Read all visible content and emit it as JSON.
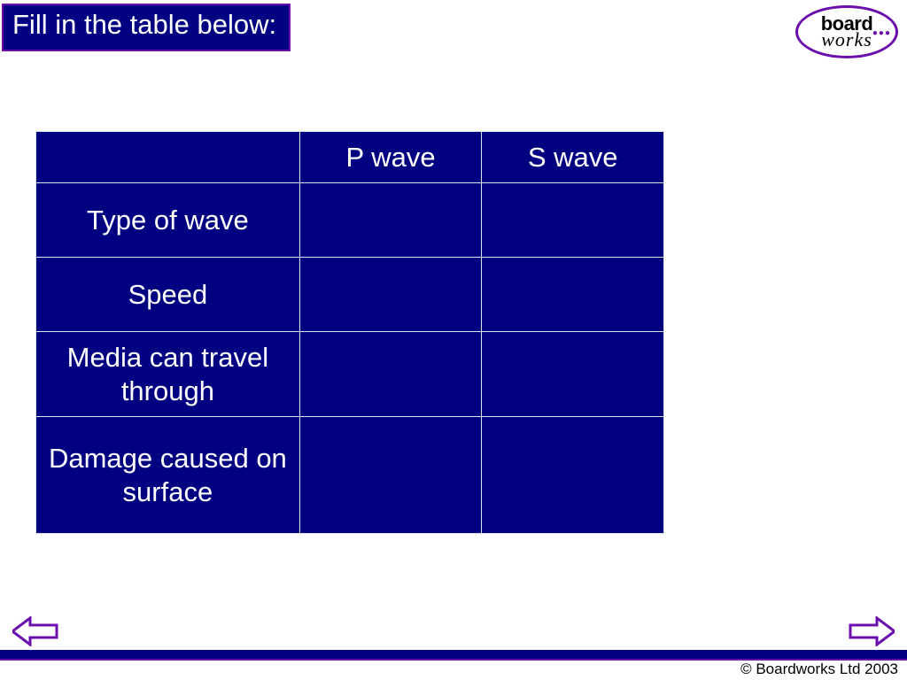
{
  "title": "Fill in the table below:",
  "logo": {
    "board": "board",
    "works": "works"
  },
  "table": {
    "headers": [
      "",
      "P wave",
      "S wave"
    ],
    "rows": [
      {
        "label": "Type of wave",
        "p": "",
        "s": ""
      },
      {
        "label": "Speed",
        "p": "",
        "s": ""
      },
      {
        "label": "Media can travel through",
        "p": "",
        "s": ""
      },
      {
        "label": "Damage caused on surface",
        "p": "",
        "s": ""
      }
    ]
  },
  "footer": {
    "copyright": "© Boardworks Ltd 2003"
  }
}
